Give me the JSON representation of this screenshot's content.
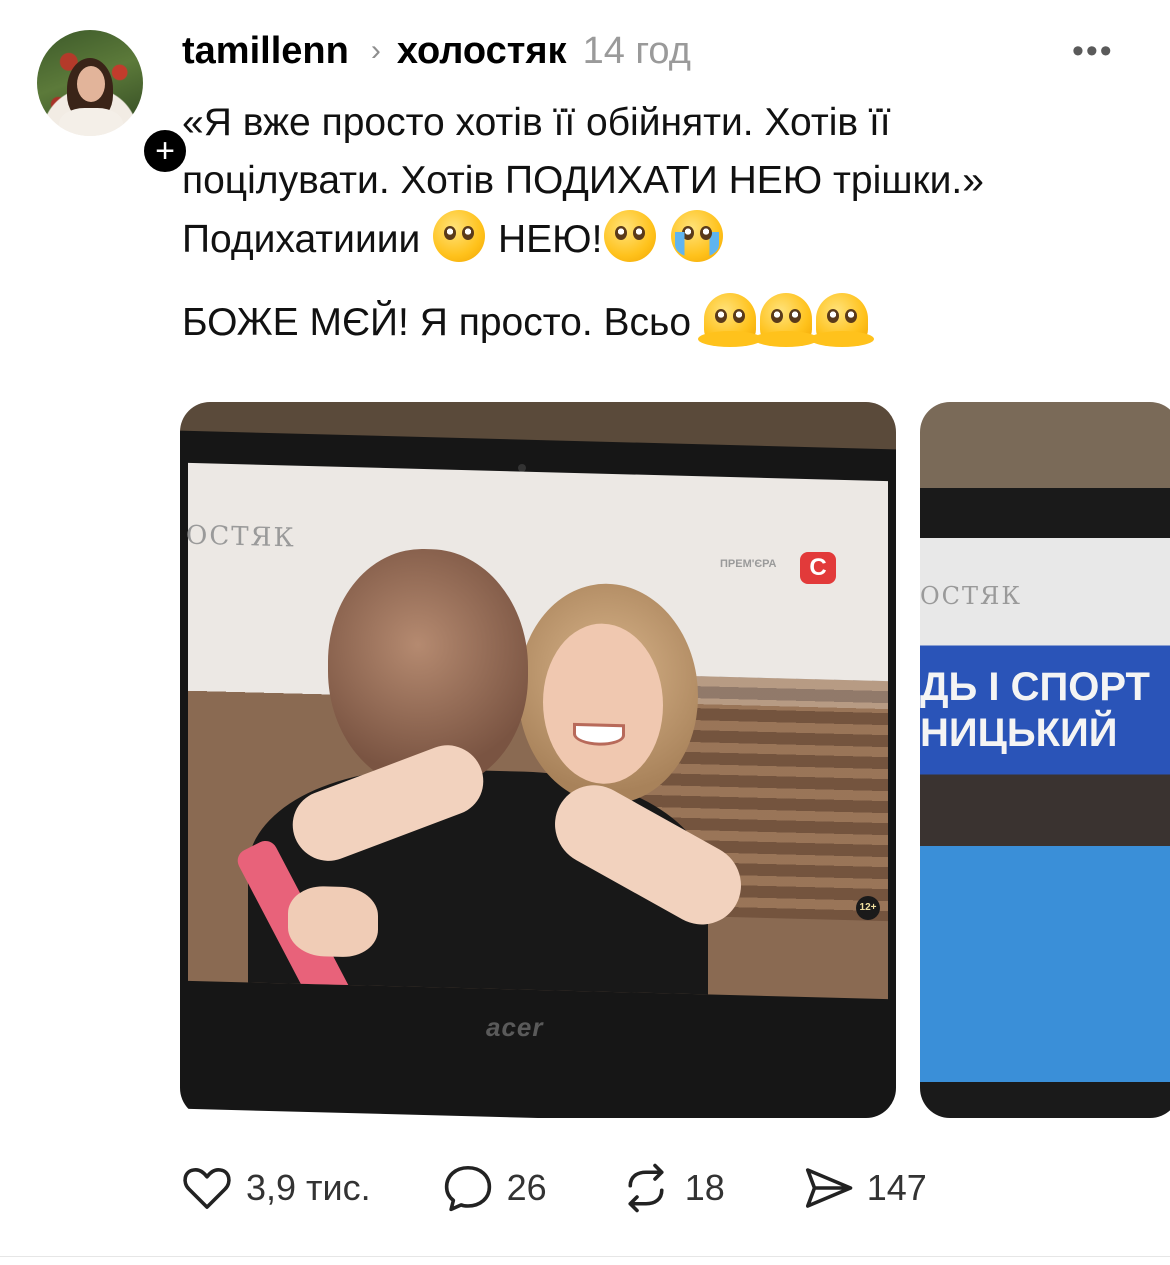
{
  "post": {
    "username": "tamillenn",
    "community": "холостяк",
    "timestamp": "14 год",
    "more_label": "•••",
    "follow_label": "+",
    "lines": {
      "l1": "«Я вже просто хотів її обійняти. Хотів її",
      "l2": "поцілувати. Хотів ПОДИХАТИ НЕЮ трішки.»",
      "l3a": "Подихатииии",
      "l3b": "НЕЮ!",
      "l4": "БОЖЕ МЄЙ! Я просто. Всьо"
    },
    "emoji": [
      "pleading-face",
      "pleading-face",
      "loudly-crying-face",
      "melting-face",
      "melting-face",
      "melting-face"
    ]
  },
  "media": {
    "photo1": {
      "tv_logo": "OСТЯК",
      "premiere": "ПРЕМ'ЄРА",
      "channel": "C",
      "age_rating": "12+",
      "brand": "acer"
    },
    "photo2": {
      "tv_logo": "OСТЯК",
      "banner_line1": "ДЬ І СПОРТ",
      "banner_line2": "НИЦЬКИЙ"
    }
  },
  "actions": {
    "likes": "3,9 тис.",
    "replies": "26",
    "reposts": "18",
    "shares": "147"
  }
}
